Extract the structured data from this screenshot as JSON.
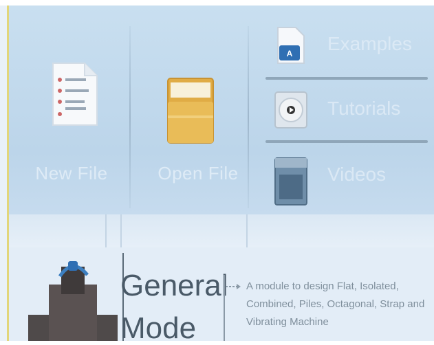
{
  "ribbon": {
    "new_file_label": "New File",
    "open_file_label": "Open File",
    "examples_label": "Examples",
    "tutorials_label": "Tutorials",
    "videos_label": "Videos"
  },
  "mode": {
    "title_line1": "General",
    "title_line2": "Mode",
    "description": "A module to design Flat, Isolated, Combined, Piles, Octagonal, Strap and Vibrating Machine"
  },
  "colors": {
    "ribbon_bg": "#bcd5ea",
    "lower_bg": "#e3edf7",
    "folder": "#e3b24a",
    "separator": "#8fa6b9"
  },
  "icons": {
    "new_file": "document-icon",
    "open_file": "folder-icon",
    "examples": "example-document-icon",
    "tutorials": "media-disc-icon",
    "videos": "video-icon",
    "mode": "building-icon"
  }
}
